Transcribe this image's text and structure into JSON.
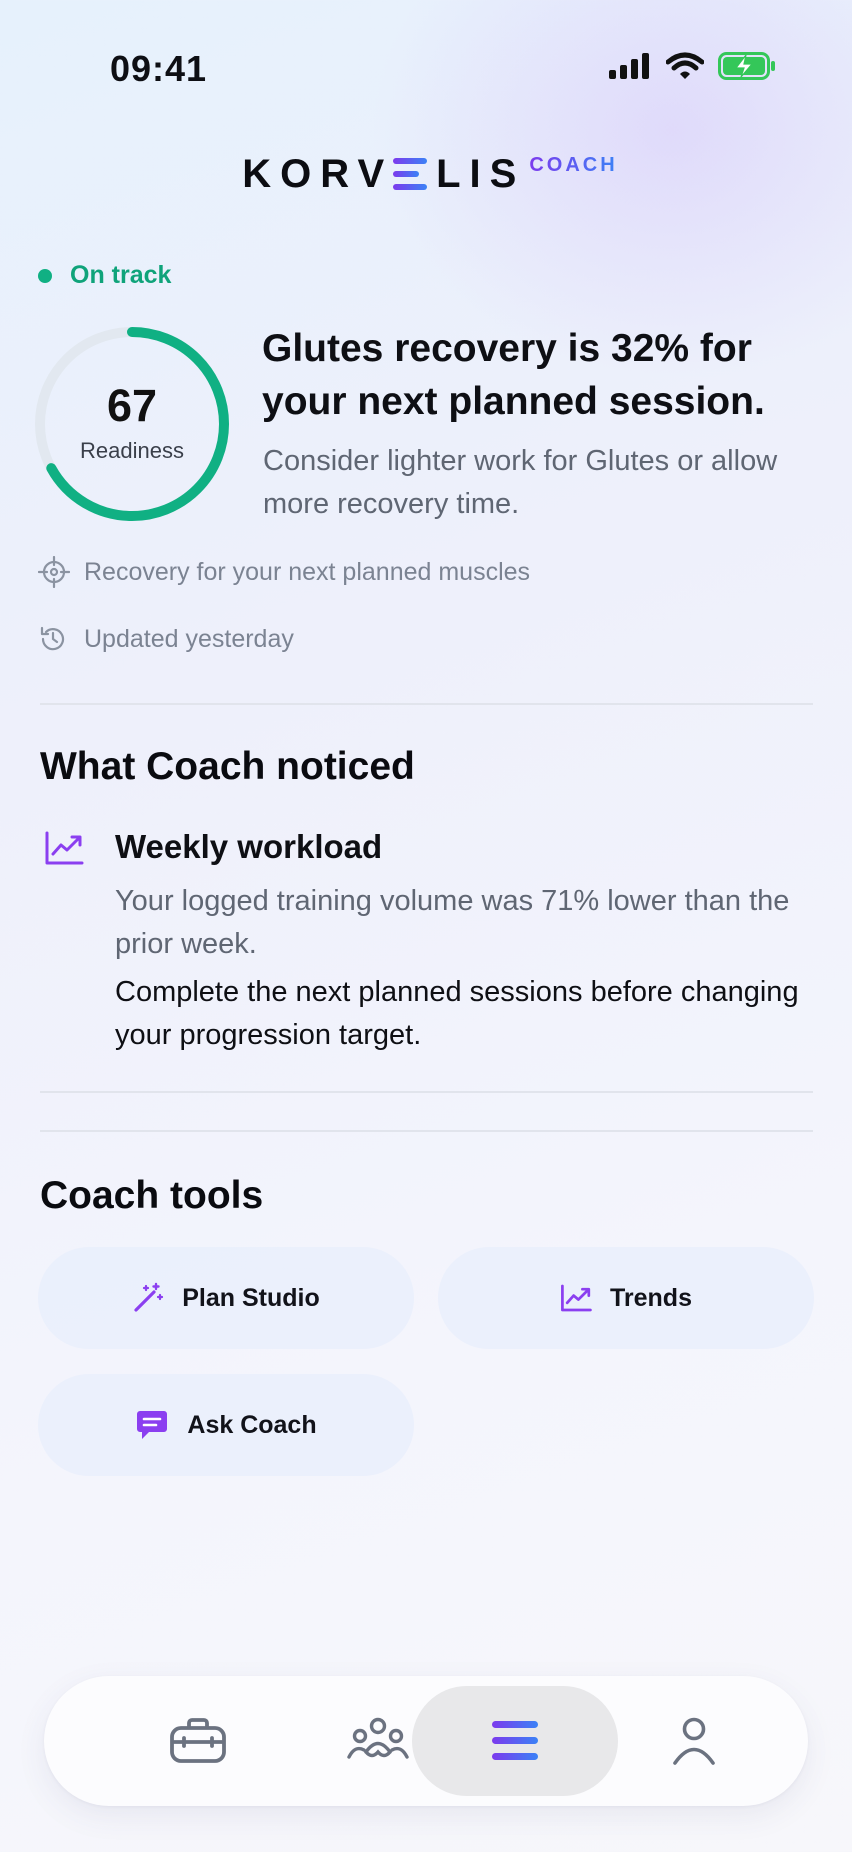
{
  "status_bar": {
    "time": "09:41"
  },
  "brand": {
    "name_left": "KORV",
    "name_right": "LIS",
    "sub": "COACH"
  },
  "status": {
    "label": "On track",
    "color": "#10b083"
  },
  "readiness": {
    "score": "67",
    "label": "Readiness",
    "progress": 0.67
  },
  "headline": "Glutes recovery is 32% for your next planned session.",
  "subtext": "Consider lighter work for Glutes or allow more recovery time.",
  "meta": {
    "target_text": "Recovery for your next planned muscles",
    "updated_text": "Updated yesterday"
  },
  "noticed": {
    "title": "What Coach noticed",
    "items": [
      {
        "icon": "trend-chart-icon",
        "title": "Weekly workload",
        "body": "Your logged training volume was 71% lower than the prior week.",
        "action": "Complete the next planned sessions before changing your progression target."
      }
    ]
  },
  "tools": {
    "title": "Coach tools",
    "items": [
      {
        "label": "Plan Studio",
        "icon": "magic-wand-icon"
      },
      {
        "label": "Trends",
        "icon": "trend-chart-icon"
      },
      {
        "label": "Ask Coach",
        "icon": "chat-bubble-icon"
      }
    ]
  },
  "tab_bar": {
    "items": [
      {
        "icon": "briefcase-icon"
      },
      {
        "icon": "community-icon"
      },
      {
        "icon": "coach-menu-icon",
        "active": true
      },
      {
        "icon": "profile-icon"
      }
    ]
  },
  "colors": {
    "accent": "#7c3aed",
    "accent_secondary": "#3b82f6",
    "success": "#10b083"
  }
}
